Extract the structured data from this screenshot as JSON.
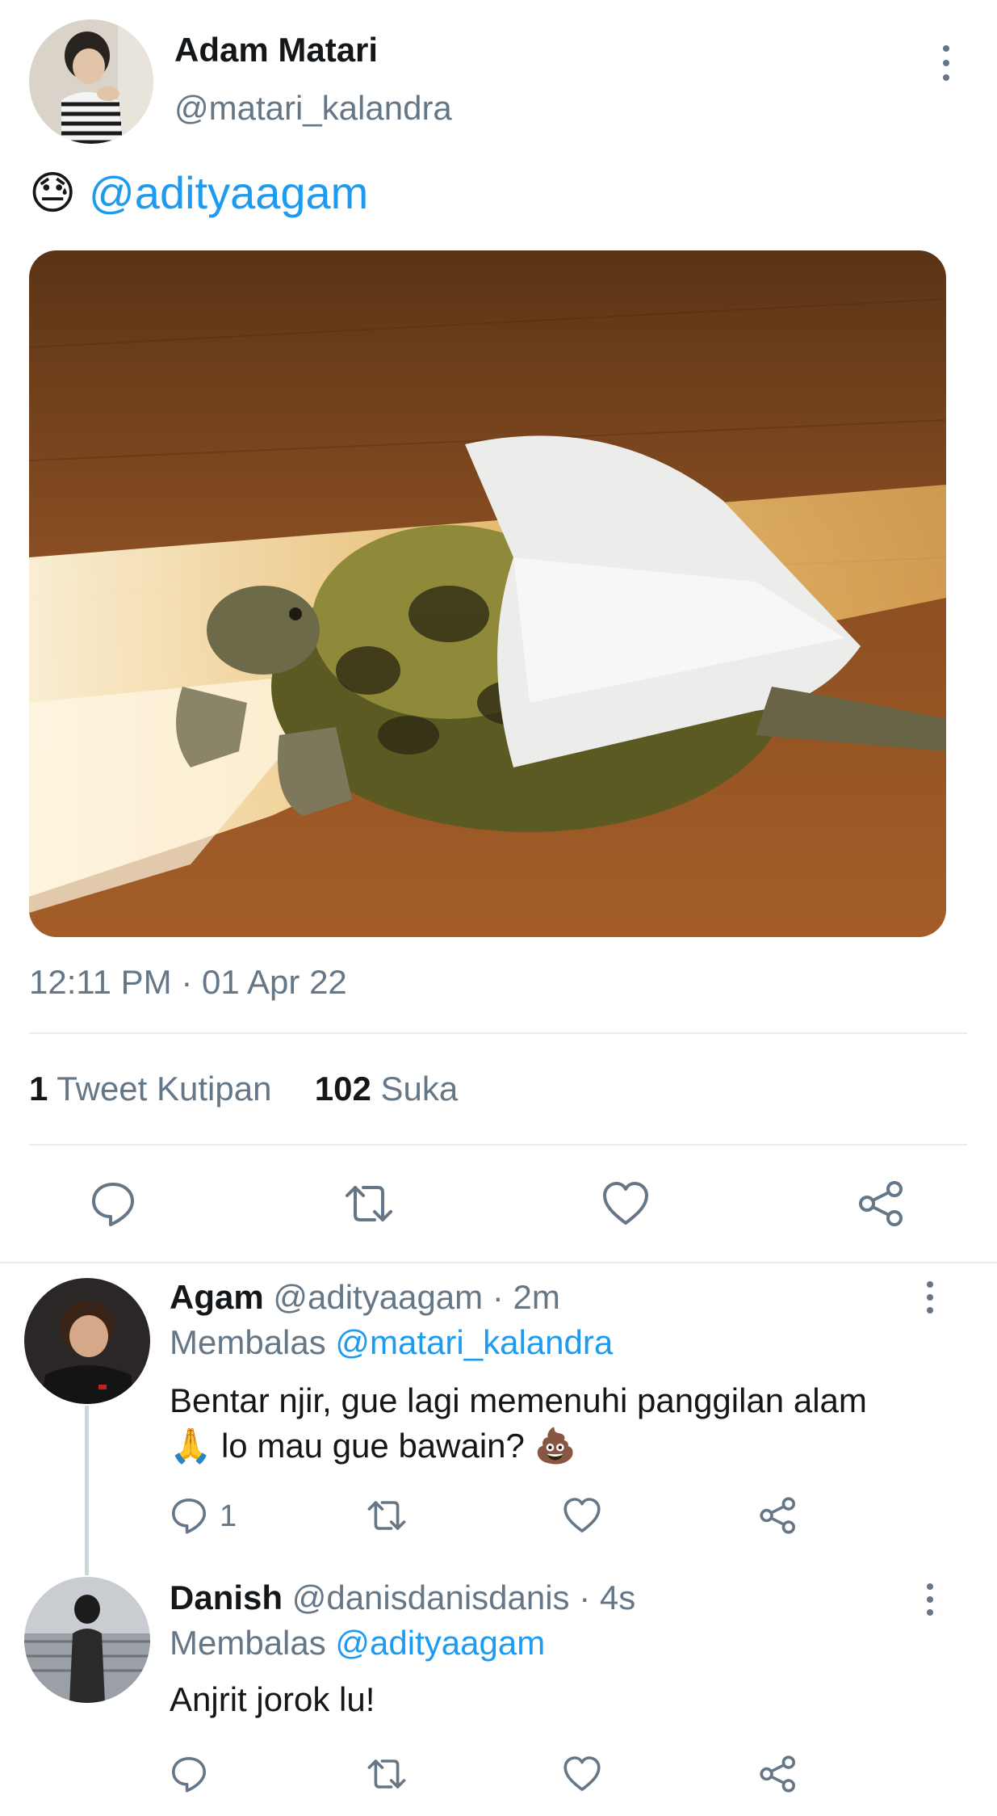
{
  "tweet": {
    "author_name": "Adam Matari",
    "author_handle": "@matari_kalandra",
    "emoji_text": "😓",
    "mention": "@adityaagam",
    "timestamp": "12:11 PM · 01 Apr 22",
    "quote_count": "1",
    "quote_label": "Tweet Kutipan",
    "like_count": "102",
    "like_label": "Suka",
    "image_icon": "turtle-photo"
  },
  "colors": {
    "link": "#1d9bf0",
    "secondary_text": "#657786",
    "divider": "#e6ecf0"
  },
  "replies": [
    {
      "name": "Agam",
      "handle": "@adityaagam",
      "time": "· 2m",
      "replying_label": "Membalas",
      "replying_to": "@matari_kalandra",
      "text_line1": "Bentar njir, gue lagi memenuhi panggilan alam",
      "text_line2_emoji": "🙏",
      "text_line2": "lo mau gue bawain?",
      "text_line2_end_emoji": "💩",
      "reply_count": "1"
    },
    {
      "name": "Danish",
      "handle": "@danisdanisdanis",
      "time": "· 4s",
      "replying_label": "Membalas",
      "replying_to": "@adityaagam",
      "text_line1": "Anjrit jorok lu!"
    }
  ]
}
